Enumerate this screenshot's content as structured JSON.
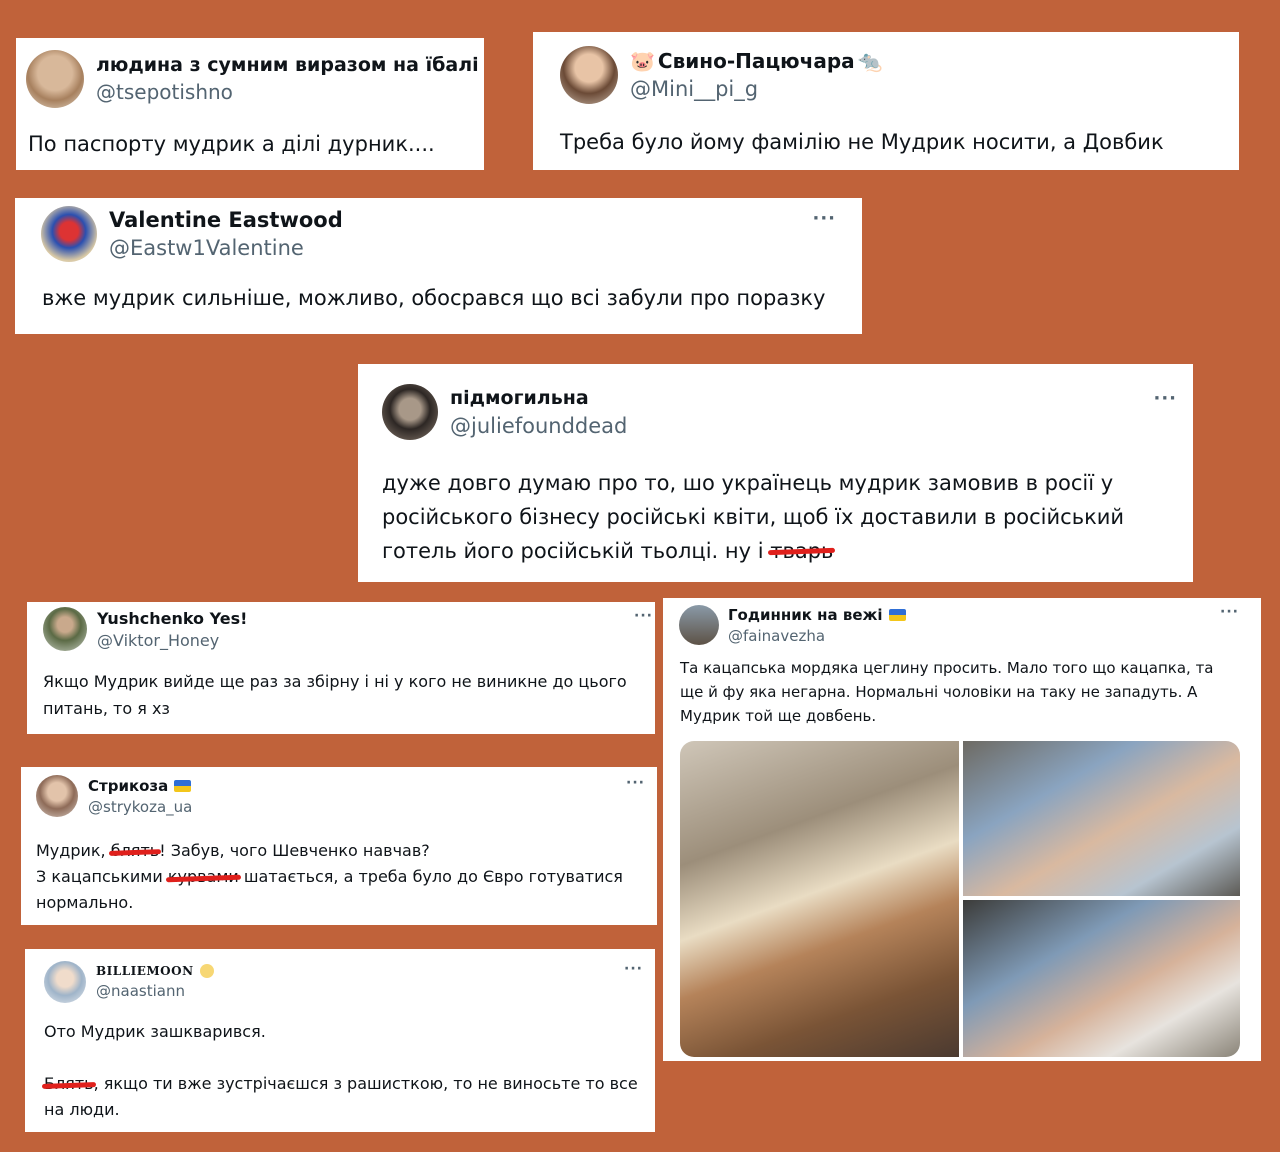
{
  "tweets": [
    {
      "name": "людина з сумним виразом на їбалі",
      "handle": "@tsepotishno",
      "text": "По паспорту мудрик а ділі дурник...."
    },
    {
      "name_prefix_icon": "🐷",
      "name": "Свино-Пацючара",
      "name_suffix_icon": "🐀",
      "handle": "@Mini__pi_g",
      "text": "Треба було йому фамілію не Мудрик носити, а Довбик"
    },
    {
      "name": "Valentine Eastwood",
      "handle": "@Eastw1Valentine",
      "more": "···",
      "text": "вже мудрик сильніше, можливо, обосрався що всі забули про поразку"
    },
    {
      "name": "підмогильна",
      "handle": "@juliefounddead",
      "more": "···",
      "text_lines": [
        "дуже довго думаю про то, шо українець мудрик замовив в росії у",
        "російського бізнесу російські квіти, щоб їх доставили в російський",
        "готель його російській тьолці. ну і "
      ],
      "censored": "тварь"
    },
    {
      "name": "Yushchenko Yes!",
      "handle": "@Viktor_Honey",
      "more": "···",
      "text": "Якщо Мудрик вийде ще раз за збірну і ні у кого не виникне до цього питань, то я хз"
    },
    {
      "name": "Годинник на вежі",
      "handle": "@fainavezha",
      "more": "···",
      "text": "Та  кацапська мордяка цеглину просить. Мало того що кацапка, та ще й фу яка негарна. Нормальні чоловіки на таку не западуть. А Мудрик той ще довбень."
    },
    {
      "name": "Стрикоза",
      "handle": "@strykoza_ua",
      "more": "···",
      "l1a": "Мудрик, ",
      "c1": "блять",
      "l1b": "! Забув, чого Шевченко навчав?",
      "l2a": "З кацапськими ",
      "c2": "курвами",
      "l2b": " шатається, а треба було до Євро готуватися",
      "l3": "нормально."
    },
    {
      "name": "BILLIEMOON",
      "handle": "@naastiann",
      "more": "···",
      "p1": "Ото Мудрик зашкварився.",
      "c": "Блять",
      "p2": ", якщо ти вже зустрічаєшся з рашисткою, то не виносьте то все на люди."
    }
  ],
  "colors": {
    "background": "#c0623a",
    "handle": "#536471",
    "censor": "#e0201c"
  }
}
